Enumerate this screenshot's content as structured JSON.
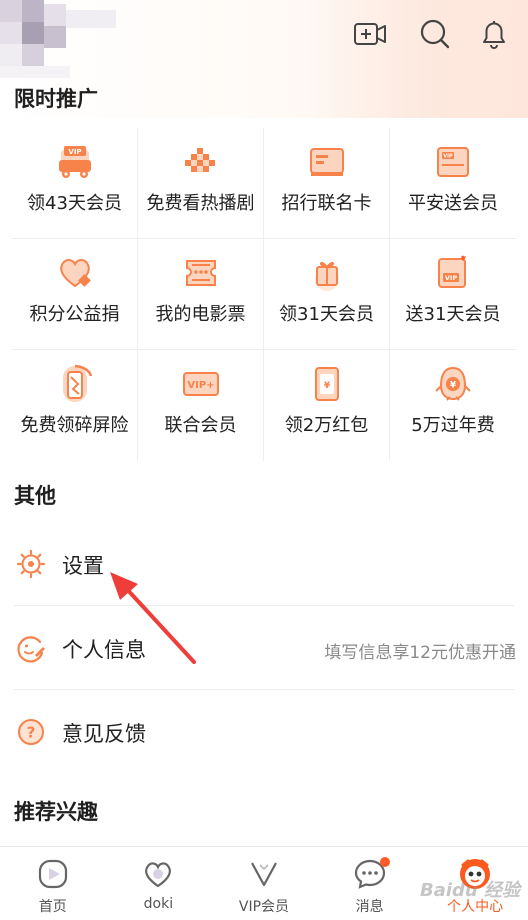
{
  "header": {
    "section_title_partial": "限时推广",
    "icons": [
      "video-call-icon",
      "search-icon",
      "bell-icon"
    ]
  },
  "promo_grid": [
    [
      {
        "label": "领43天会员",
        "icon": "vip-car-icon"
      },
      {
        "label": "免费看热播剧",
        "icon": "checker-icon"
      },
      {
        "label": "招行联名卡",
        "icon": "bank-card-icon"
      },
      {
        "label": "平安送会员",
        "icon": "vip-card-icon"
      }
    ],
    [
      {
        "label": "积分公益捐",
        "icon": "heart-icon"
      },
      {
        "label": "我的电影票",
        "icon": "ticket-icon"
      },
      {
        "label": "领31天会员",
        "icon": "gift-icon"
      },
      {
        "label": "送31天会员",
        "icon": "vip-send-icon"
      }
    ],
    [
      {
        "label": "免费领碎屏险",
        "icon": "phone-shield-icon"
      },
      {
        "label": "联合会员",
        "icon": "vip-plus-icon"
      },
      {
        "label": "领2万红包",
        "icon": "red-packet-icon"
      },
      {
        "label": "5万过年费",
        "icon": "penguin-yen-icon"
      }
    ]
  ],
  "other": {
    "title": "其他",
    "items": [
      {
        "label": "设置",
        "icon": "settings-icon",
        "hint": ""
      },
      {
        "label": "个人信息",
        "icon": "profile-edit-icon",
        "hint": "填写信息享12元优惠开通"
      },
      {
        "label": "意见反馈",
        "icon": "feedback-icon",
        "hint": ""
      }
    ]
  },
  "interests": {
    "title": "推荐兴趣"
  },
  "bottom_nav": [
    {
      "label": "首页",
      "icon": "home-play-icon",
      "active": false
    },
    {
      "label": "doki",
      "icon": "doki-icon",
      "active": false
    },
    {
      "label": "VIP会员",
      "icon": "vip-crown-icon",
      "active": false
    },
    {
      "label": "消息",
      "icon": "message-icon",
      "active": false,
      "badge": true
    },
    {
      "label": "个人中心",
      "icon": "mascot-avatar-icon",
      "active": true
    }
  ],
  "colors": {
    "accent": "#ff5a1e",
    "icon_orange": "#f7824a",
    "icon_light": "#fbd5bf"
  },
  "watermark": "Baidu 经验"
}
